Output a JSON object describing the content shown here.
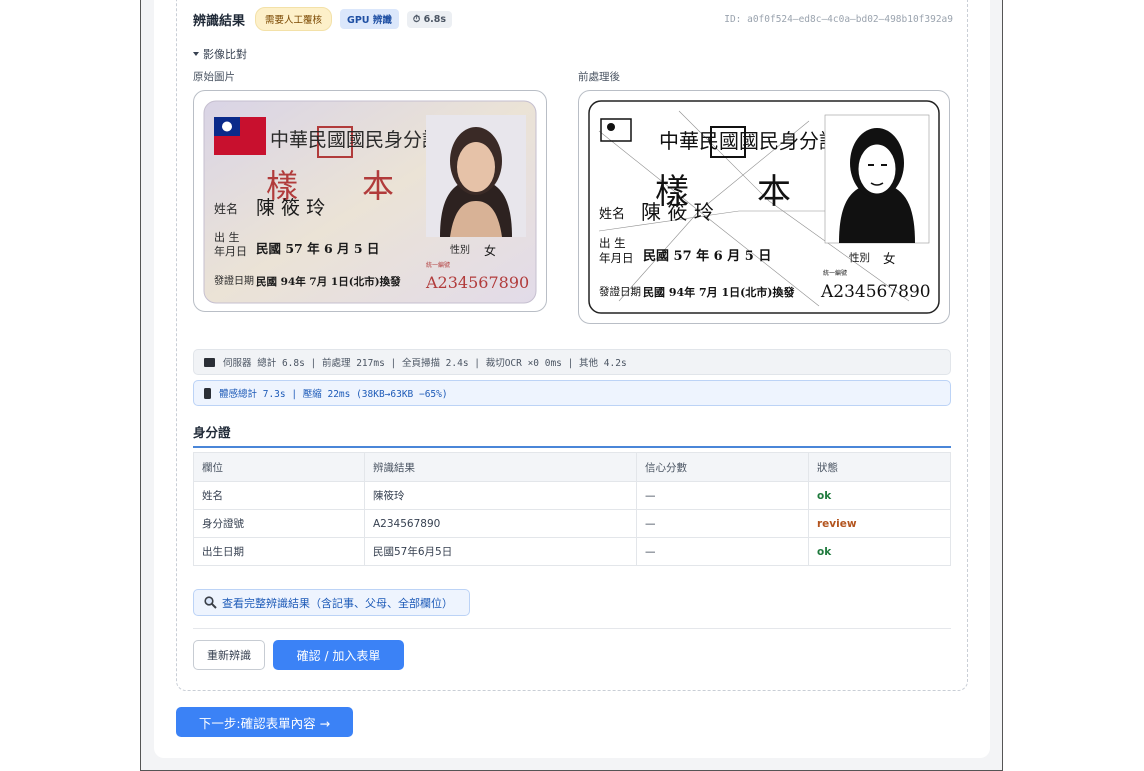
{
  "result": {
    "title": "辨識結果",
    "badge_review": "需要人工覆核",
    "badge_gpu": "GPU 辨識",
    "badge_time": "6.8s",
    "record_id": "ID: a0f0f524–ed8c–4c0a–bd02–498b10f392a9"
  },
  "compare": {
    "toggle_label": "影像比對",
    "original_label": "原始圖片",
    "processed_label": "前處理後"
  },
  "idcard": {
    "header": "中華民國國民身分證",
    "sample_left": "樣",
    "sample_right": "本",
    "name_label": "姓名",
    "name_value": "陳 筱 玲",
    "birth_label_1": "出 生",
    "birth_label_2": "年月日",
    "birth_value": "民國 57 年 6 月 5 日",
    "sex_label": "性別",
    "sex_value": "女",
    "issue_label": "發證日期",
    "issue_value": "民國 94年 7月 1日(北市)換發",
    "id_caption": "統一編號",
    "id_number": "A234567890"
  },
  "stats": {
    "server_text": "伺服器 總計 6.8s | 前處理 217ms | 全頁掃描 2.4s | 裁切OCR ×0 0ms | 其他 4.2s",
    "device_text": "體感總計 7.3s | 壓縮 22ms (38KB→63KB −65%)"
  },
  "section_title": "身分證",
  "table": {
    "headers": [
      "欄位",
      "辨識結果",
      "信心分數",
      "狀態"
    ],
    "rows": [
      {
        "field": "姓名",
        "value": "陳筱玲",
        "confidence": "—",
        "status": "ok"
      },
      {
        "field": "身分證號",
        "value": "A234567890",
        "confidence": "—",
        "status": "review"
      },
      {
        "field": "出生日期",
        "value": "民國57年6月5日",
        "confidence": "—",
        "status": "ok"
      }
    ]
  },
  "actions": {
    "full_result": "查看完整辨識結果（含記事、父母、全部欄位）",
    "redo": "重新辨識",
    "confirm": "確認 / 加入表單",
    "next": "下一步:確認表單內容 →"
  },
  "colors": {
    "accent": "#3b82f6",
    "ok": "#1f7a3d",
    "review": "#b3541e",
    "warn_bg": "#fdf0c9"
  }
}
